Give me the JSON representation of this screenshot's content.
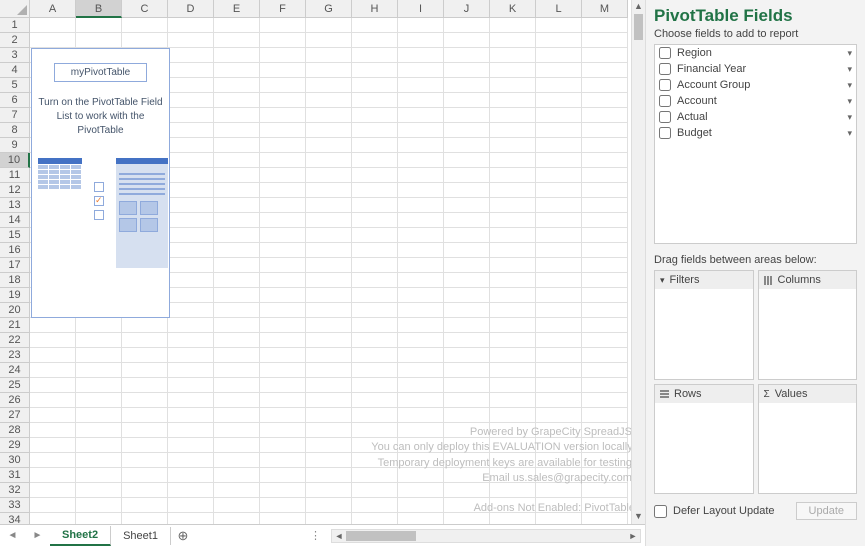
{
  "columns": [
    "A",
    "B",
    "C",
    "D",
    "E",
    "F",
    "G",
    "H",
    "I",
    "J",
    "K",
    "L",
    "M"
  ],
  "rowCount": 34,
  "selectedCol": "B",
  "selectedRow": 10,
  "pivotBox": {
    "title": "myPivotTable",
    "message": "Turn on the PivotTable Field List to work with the PivotTable"
  },
  "watermark": {
    "l1": "Powered by GrapeCity SpreadJS.",
    "l2": "You can only deploy this EVALUATION version locally.",
    "l3": "Temporary deployment keys are available for testing.",
    "l4": "Email us.sales@grapecity.com.",
    "l5": "Add-ons Not Enabled: PivotTable"
  },
  "tabs": {
    "active": "Sheet2",
    "other": "Sheet1"
  },
  "pane": {
    "title": "PivotTable Fields",
    "subtitle": "Choose fields to add to report",
    "fields": [
      "Region",
      "Financial Year",
      "Account Group",
      "Account",
      "Actual",
      "Budget"
    ],
    "areasLabel": "Drag fields between areas below:",
    "areas": {
      "filters": "Filters",
      "columns": "Columns",
      "rows": "Rows",
      "values": "Values"
    },
    "defer": "Defer Layout Update",
    "update": "Update"
  }
}
